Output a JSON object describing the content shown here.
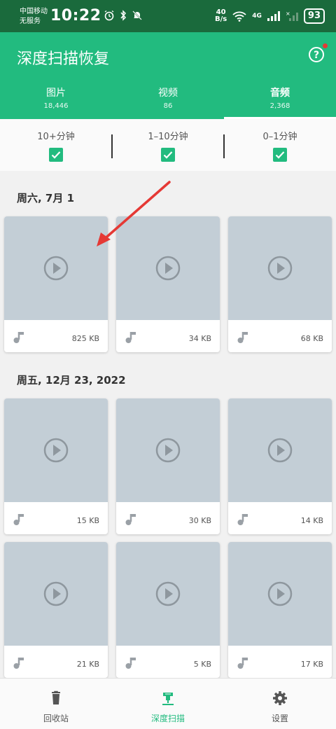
{
  "status_bar": {
    "carrier_line1": "中国移动",
    "carrier_line2": "无服务",
    "time": "10:22",
    "net_speed_value": "40",
    "net_speed_unit": "B/s",
    "network_type": "4G",
    "battery": "93"
  },
  "header": {
    "title": "深度扫描恢复",
    "tabs": [
      {
        "label": "图片",
        "count": "18,446"
      },
      {
        "label": "视频",
        "count": "86"
      },
      {
        "label": "音频",
        "count": "2,368"
      }
    ],
    "active_tab": 2
  },
  "filters": [
    {
      "label": "10+分钟",
      "checked": true
    },
    {
      "label": "1–10分钟",
      "checked": true
    },
    {
      "label": "0–1分钟",
      "checked": true
    }
  ],
  "groups": [
    {
      "date": "周六, 7月 1",
      "items": [
        {
          "size": "825 KB"
        },
        {
          "size": "34 KB"
        },
        {
          "size": "68 KB"
        }
      ]
    },
    {
      "date": "周五, 12月 23, 2022",
      "items": [
        {
          "size": "15 KB"
        },
        {
          "size": "30 KB"
        },
        {
          "size": "14 KB"
        },
        {
          "size": "21 KB"
        },
        {
          "size": "5 KB"
        },
        {
          "size": "17 KB"
        }
      ]
    }
  ],
  "bottom_nav": [
    {
      "label": "回收站",
      "icon": "trash-icon"
    },
    {
      "label": "深度扫描",
      "icon": "deep-scan-icon"
    },
    {
      "label": "设置",
      "icon": "gear-icon"
    }
  ],
  "active_nav": 1,
  "colors": {
    "accent": "#22bb7f",
    "status_bar": "#1a6a3c",
    "thumbnail": "#c3ced6",
    "annotation_arrow": "#e53935"
  }
}
